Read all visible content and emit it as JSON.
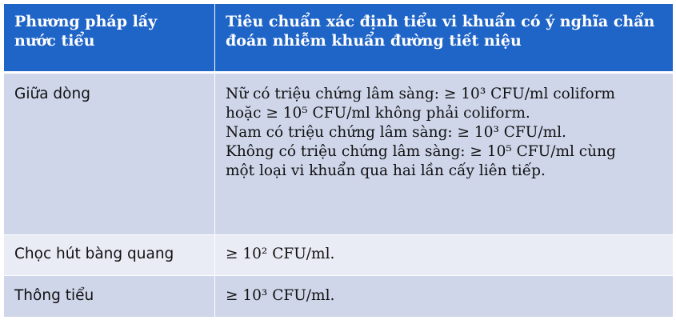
{
  "table": {
    "headers": [
      "Phương pháp lấy nước tiểu",
      "Tiêu chuẩn xác định tiểu vi khuẩn có ý nghĩa chẩn đoán nhiễm khuẩn đường tiết niệu"
    ],
    "header_lines": [
      [
        "Phương pháp lấy",
        "nước tiểu"
      ],
      [
        "Tiêu chuẩn xác định tiểu vi khuẩn có ý nghĩa chẩn",
        "đoán nhiễm khuẩn đường tiết niệu"
      ]
    ],
    "rows": [
      {
        "method": "Giữa dòng",
        "criteria_lines": [
          "Nữ có triệu chứng lâm sàng: ≥ 10³ CFU/ml coliform",
          "hoặc ≥ 10⁵ CFU/ml không phải coliform.",
          "Nam có triệu chứng lâm sàng: ≥ 10³ CFU/ml.",
          "Không có triệu chứng lâm sàng: ≥ 10⁵ CFU/ml cùng",
          "một loại vi khuẩn qua hai lần cấy liên tiếp."
        ]
      },
      {
        "method": "Chọc hút bàng quang",
        "criteria_lines": [
          "≥ 10² CFU/ml."
        ]
      },
      {
        "method": "Thông tiểu",
        "criteria_lines": [
          "≥ 10³ CFU/ml."
        ]
      }
    ]
  },
  "colors": {
    "header_bg": "#1f64c7",
    "row_dark": "#cfd6ea",
    "row_light": "#e9ecf5",
    "header_text": "#ffffff"
  }
}
